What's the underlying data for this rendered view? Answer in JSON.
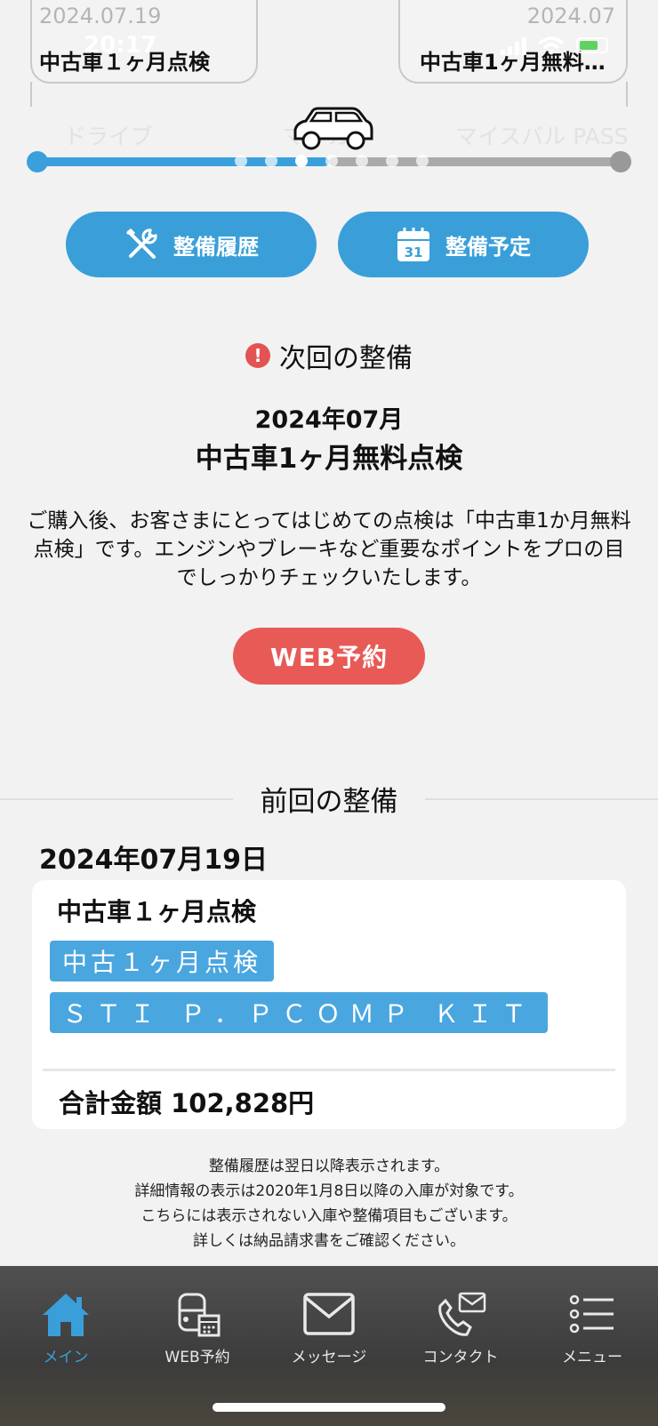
{
  "status_bar": {
    "time": "20:17"
  },
  "timeline": {
    "left_bubble": {
      "date": "2024.07.19",
      "title": "中古車１ヶ月点検"
    },
    "right_bubble": {
      "date": "2024.07",
      "title": "中古車1ヶ月無料…"
    },
    "labels": {
      "left": "ドライブ",
      "center": "マイカー",
      "right": "マイスバル PASS"
    }
  },
  "actions": {
    "history_label": "整備履歴",
    "schedule_label": "整備予定",
    "calendar_day": "31"
  },
  "next_maintenance": {
    "heading": "次回の整備",
    "alert_icon": "!",
    "date": "2024年07月",
    "title": "中古車1ヶ月無料点検",
    "description": "ご購入後、お客さまにとってはじめての点検は「中古車1か月無料点検」です。エンジンやブレーキなど重要なポイントをプロの目でしっかりチェックいたします。",
    "web_button": "WEB予約"
  },
  "previous_maintenance": {
    "heading": "前回の整備",
    "date": "2024年07月19日",
    "card": {
      "title": "中古車１ヶ月点検",
      "tags": [
        "中古１ヶ月点検",
        "ＳＴＩ Ｐ．ＰＣＯＭＰ ＫＩＴ"
      ],
      "total": "合計金額 102,828円"
    }
  },
  "notes": [
    "整備履歴は翌日以降表示されます。",
    "詳細情報の表示は2020年1月8日以降の入庫が対象です。",
    "こちらには表示されない入庫や整備項目もございます。",
    "詳しくは納品請求書をご確認ください。"
  ],
  "nav": {
    "items": [
      {
        "label": "メイン",
        "icon": "home-icon"
      },
      {
        "label": "WEB予約",
        "icon": "car-calendar-icon"
      },
      {
        "label": "メッセージ",
        "icon": "mail-icon"
      },
      {
        "label": "コンタクト",
        "icon": "phone-mail-icon"
      },
      {
        "label": "メニュー",
        "icon": "menu-list-icon"
      }
    ]
  },
  "colors": {
    "accent": "#3a9fd9",
    "web_button": "#e85a55",
    "alert": "#e35353"
  }
}
